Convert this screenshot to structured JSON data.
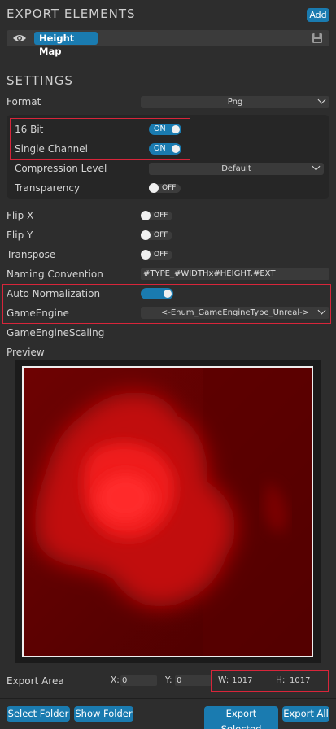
{
  "export_elements": {
    "title": "EXPORT ELEMENTS",
    "add_label": "Add",
    "item_label": "Height Map"
  },
  "settings": {
    "title": "SETTINGS",
    "format_label": "Format",
    "format_value": "Png",
    "bit16_label": "16 Bit",
    "bit16_state": "ON",
    "single_channel_label": "Single Channel",
    "single_channel_state": "ON",
    "compression_label": "Compression Level",
    "compression_value": "Default",
    "transparency_label": "Transparency",
    "transparency_state": "OFF",
    "flipx_label": "Flip X",
    "flipx_state": "OFF",
    "flipy_label": "Flip Y",
    "flipy_state": "OFF",
    "transpose_label": "Transpose",
    "transpose_state": "OFF",
    "naming_label": "Naming Convention",
    "naming_value": "#TYPE_#WIDTHx#HEIGHT.#EXT",
    "auto_norm_label": "Auto Normalization",
    "game_engine_label": "GameEngine",
    "game_engine_value": "<-Enum_GameEngineType_Unreal->",
    "game_engine_scaling_label": "GameEngineScaling",
    "preview_label": "Preview"
  },
  "export_area": {
    "label": "Export Area",
    "x_label": "X:",
    "x_value": "0",
    "y_label": "Y:",
    "y_value": "0",
    "w_label": "W:",
    "w_value": "1017",
    "h_label": "H:",
    "h_value": "1017"
  },
  "footer": {
    "select_folder": "Select Folder",
    "show_folder": "Show Folder",
    "export_selected": "Export Selected",
    "export_all": "Export All"
  },
  "colors": {
    "accent": "#1a7bb0",
    "highlight_box": "#d8253a"
  }
}
